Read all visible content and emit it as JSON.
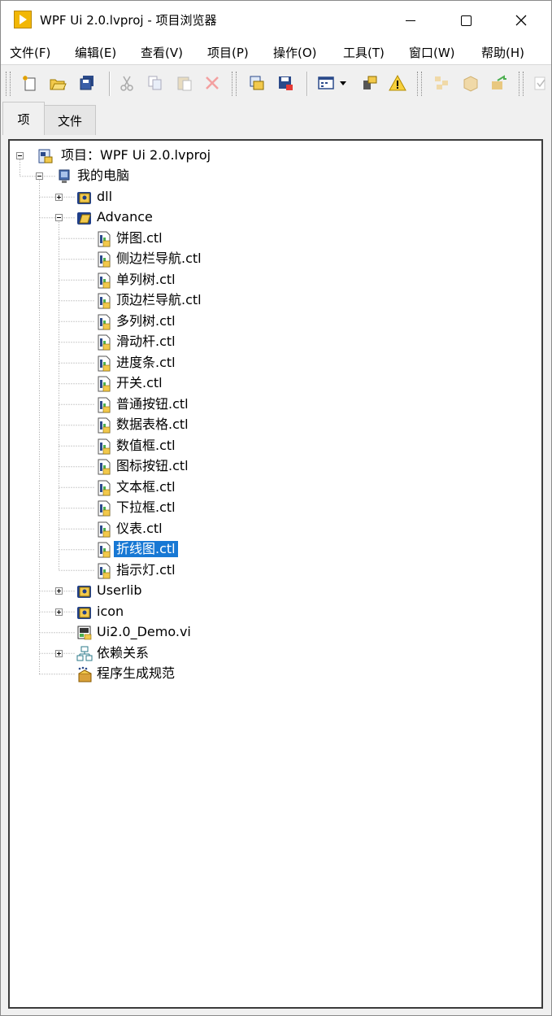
{
  "window": {
    "title": "WPF Ui 2.0.lvproj - 项目浏览器"
  },
  "menu": [
    "文件(F)",
    "编辑(E)",
    "查看(V)",
    "项目(P)",
    "操作(O)",
    "工具(T)",
    "窗口(W)",
    "帮助(H)"
  ],
  "toolbar": [
    "new-icon",
    "open-icon",
    "save-all-icon",
    "cut-icon",
    "copy-icon",
    "paste-icon",
    "delete-icon",
    "build-icon",
    "save-icon",
    "view-icon",
    "dropdown-icon",
    "settings-icon",
    "warning-icon",
    "ungroup-icon",
    "package-icon",
    "export-icon",
    "more-icon"
  ],
  "tabs": [
    "项",
    "文件"
  ],
  "tree": [
    {
      "id": "root",
      "label": "项目：WPF Ui 2.0.lvproj",
      "icon": "project-icon",
      "depth": 0,
      "expander": "minus"
    },
    {
      "id": "mycomputer",
      "label": "我的电脑",
      "icon": "computer-icon",
      "depth": 1,
      "expander": "minus"
    },
    {
      "id": "dll",
      "label": "dll",
      "icon": "folder-icon",
      "depth": 2,
      "expander": "plus"
    },
    {
      "id": "advance",
      "label": "Advance",
      "icon": "folder-open-icon",
      "depth": 2,
      "expander": "minus"
    },
    {
      "id": "c1",
      "label": "饼图.ctl",
      "icon": "control-file-icon",
      "depth": 3
    },
    {
      "id": "c2",
      "label": "侧边栏导航.ctl",
      "icon": "control-file-icon",
      "depth": 3
    },
    {
      "id": "c3",
      "label": "单列树.ctl",
      "icon": "control-file-icon",
      "depth": 3
    },
    {
      "id": "c4",
      "label": "顶边栏导航.ctl",
      "icon": "control-file-icon",
      "depth": 3
    },
    {
      "id": "c5",
      "label": "多列树.ctl",
      "icon": "control-file-icon",
      "depth": 3
    },
    {
      "id": "c6",
      "label": "滑动杆.ctl",
      "icon": "control-file-icon",
      "depth": 3
    },
    {
      "id": "c7",
      "label": "进度条.ctl",
      "icon": "control-file-icon",
      "depth": 3
    },
    {
      "id": "c8",
      "label": "开关.ctl",
      "icon": "control-file-icon",
      "depth": 3
    },
    {
      "id": "c9",
      "label": "普通按钮.ctl",
      "icon": "control-file-icon",
      "depth": 3
    },
    {
      "id": "c10",
      "label": "数据表格.ctl",
      "icon": "control-file-icon",
      "depth": 3
    },
    {
      "id": "c11",
      "label": "数值框.ctl",
      "icon": "control-file-icon",
      "depth": 3
    },
    {
      "id": "c12",
      "label": "图标按钮.ctl",
      "icon": "control-file-icon",
      "depth": 3
    },
    {
      "id": "c13",
      "label": "文本框.ctl",
      "icon": "control-file-icon",
      "depth": 3
    },
    {
      "id": "c14",
      "label": "下拉框.ctl",
      "icon": "control-file-icon",
      "depth": 3
    },
    {
      "id": "c15",
      "label": "仪表.ctl",
      "icon": "control-file-icon",
      "depth": 3
    },
    {
      "id": "c16",
      "label": "折线图.ctl",
      "icon": "control-file-icon",
      "depth": 3,
      "selected": true
    },
    {
      "id": "c17",
      "label": "指示灯.ctl",
      "icon": "control-file-icon",
      "depth": 3
    },
    {
      "id": "userlib",
      "label": "Userlib",
      "icon": "folder-icon",
      "depth": 2,
      "expander": "plus"
    },
    {
      "id": "iconf",
      "label": "icon",
      "icon": "folder-icon",
      "depth": 2,
      "expander": "plus"
    },
    {
      "id": "demo",
      "label": "Ui2.0_Demo.vi",
      "icon": "vi-icon",
      "depth": 2
    },
    {
      "id": "deps",
      "label": "依赖关系",
      "icon": "dependencies-icon",
      "depth": 2,
      "expander": "plus"
    },
    {
      "id": "build",
      "label": "程序生成规范",
      "icon": "build-spec-icon",
      "depth": 2
    }
  ],
  "colors": {
    "selection": "#1778d4",
    "folder": "#f2c94c",
    "window_bg": "#f0f0f0"
  }
}
